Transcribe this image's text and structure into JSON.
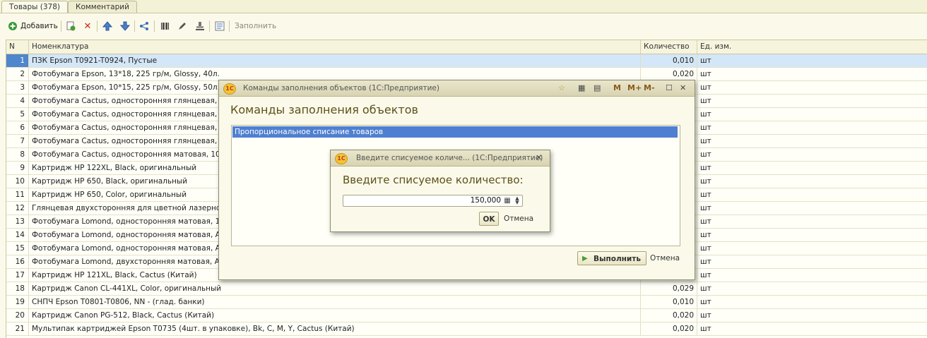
{
  "tabs": [
    "Товары (378)",
    "Комментарий"
  ],
  "toolbar": {
    "add_label": "Добавить",
    "fill_label": "Заполнить"
  },
  "grid": {
    "headers": {
      "n": "N",
      "nomenclature": "Номенклатура",
      "quantity": "Количество",
      "unit": "Ед. изм."
    },
    "rows": [
      {
        "n": "1",
        "name": "ПЗК Epson T0921-T0924, Пустые",
        "qty": "0,010",
        "unit": "шт"
      },
      {
        "n": "2",
        "name": "Фотобумага Epson, 13*18, 225 гр/м, Glossy, 40л.",
        "qty": "0,020",
        "unit": "шт"
      },
      {
        "n": "3",
        "name": "Фотобумага Epson, 10*15, 225 гр/м, Glossy, 50л.",
        "qty": "",
        "unit": "шт"
      },
      {
        "n": "4",
        "name": "Фотобумага Cactus, односторонняя глянцевая, A4,",
        "qty": "",
        "unit": "шт"
      },
      {
        "n": "5",
        "name": "Фотобумага Cactus, односторонняя глянцевая, 10x",
        "qty": "",
        "unit": "шт"
      },
      {
        "n": "6",
        "name": "Фотобумага Cactus, односторонняя глянцевая, 10x",
        "qty": "",
        "unit": "шт"
      },
      {
        "n": "7",
        "name": "Фотобумага Cactus, односторонняя глянцевая, 10x",
        "qty": "",
        "unit": "шт"
      },
      {
        "n": "8",
        "name": "Фотобумага Cactus, односторонняя матовая, 10x15",
        "qty": "",
        "unit": "шт"
      },
      {
        "n": "9",
        "name": "Картридж HP 122XL, Black, оригинальный",
        "qty": "",
        "unit": "шт"
      },
      {
        "n": "10",
        "name": "Картридж HP 650, Black, оригинальный",
        "qty": "",
        "unit": "шт"
      },
      {
        "n": "11",
        "name": "Картридж HP 650, Color, оригинальный",
        "qty": "",
        "unit": "шт"
      },
      {
        "n": "12",
        "name": "Глянцевая двухсторонняя для цветной лазерной пе",
        "qty": "",
        "unit": "шт"
      },
      {
        "n": "13",
        "name": "Фотобумага Lomond, односторонняя матовая, 10*1",
        "qty": "",
        "unit": "шт"
      },
      {
        "n": "14",
        "name": "Фотобумага Lomond, односторонняя матовая, A4, 9",
        "qty": "",
        "unit": "шт"
      },
      {
        "n": "15",
        "name": "Фотобумага Lomond, односторонняя матовая, A4, 2",
        "qty": "",
        "unit": "шт"
      },
      {
        "n": "16",
        "name": "Фотобумага Lomond, двухсторонняя матовая, A4, 1",
        "qty": "",
        "unit": "шт"
      },
      {
        "n": "17",
        "name": "Картридж HP 121XL, Black, Cactus (Китай)",
        "qty": "",
        "unit": "шт"
      },
      {
        "n": "18",
        "name": "Картридж Canon CL-441XL, Color, оригинальный",
        "qty": "0,029",
        "unit": "шт"
      },
      {
        "n": "19",
        "name": "СНПЧ Epson T0801-T0806, NN - (глад. банки)",
        "qty": "0,010",
        "unit": "шт"
      },
      {
        "n": "20",
        "name": "Картридж Canon PG-512, Black, Cactus (Китай)",
        "qty": "0,020",
        "unit": "шт"
      },
      {
        "n": "21",
        "name": "Мультипак картриджей Epson T0735 (4шт. в упаковке), Bk, C, M, Y, Cactus (Китай)",
        "qty": "0,020",
        "unit": "шт"
      }
    ]
  },
  "dialog_fill": {
    "window_title": "Команды заполнения объектов  (1С:Предприятие)",
    "heading": "Команды заполнения объектов",
    "list_items": [
      "Пропорциональное списание товаров"
    ],
    "controls": {
      "m": "M",
      "m_plus": "M+",
      "m_minus": "M-"
    },
    "execute_label": "Выполнить",
    "cancel_label": "Отмена"
  },
  "dialog_qty": {
    "window_title": "Введите списуемое количе...  (1С:Предприятие)",
    "heading": "Введите списуемое количество:",
    "value": "150,000",
    "ok_label": "OK",
    "cancel_label": "Отмена"
  },
  "colors": {
    "background": "#fbfaea",
    "selection_blue": "#4f7fd0",
    "heading_text": "#5d5019"
  }
}
